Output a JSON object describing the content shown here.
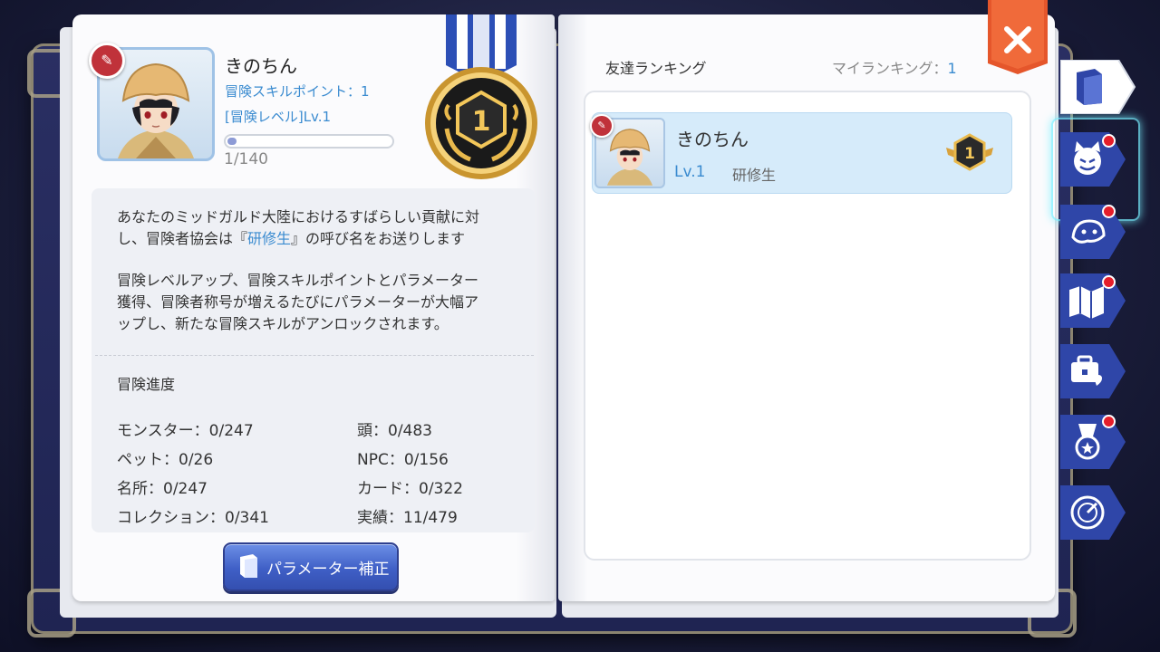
{
  "profile": {
    "name": "きのちん",
    "skill_points": "冒険スキルポイント：1",
    "adventure_level": "[冒険レベル]Lv.1",
    "exp_text": "1/140",
    "exp_progress": 0.007,
    "rank_number": "1"
  },
  "description": {
    "line1": "あなたのミッドガルド大陸におけるすばらしい貢献に対",
    "line2_pre": "し、冒険者協会は『",
    "line2_title": "研修生",
    "line2_post": "』の呼び名をお送りします",
    "para2_line1": "冒険レベルアップ、冒険スキルポイントとパラメーター",
    "para2_line2": "獲得、冒険者称号が増えるたびにパラメーターが大幅ア",
    "para2_line3": "ップし、新たな冒険スキルがアンロックされます。"
  },
  "progress": {
    "title": "冒険進度",
    "left": [
      "モンスター：0/247",
      "ペット：0/26",
      "名所：0/247",
      "コレクション：0/341"
    ],
    "right": [
      "頭：0/483",
      "NPC：0/156",
      "カード：0/322",
      "実績：11/479"
    ]
  },
  "param_button": {
    "label": "パラメーター補正"
  },
  "ranking": {
    "title": "友達ランキング",
    "my_rank_label": "マイランキング：",
    "my_rank_value": "1",
    "rows": [
      {
        "name": "きのちん",
        "level": "Lv.1",
        "class": "研修生",
        "rank": "1"
      }
    ]
  },
  "colors": {
    "accent_blue": "#3a8bd0",
    "close_red": "#e5562b",
    "tab_blue": "#2f46a8",
    "notify_red": "#e51e2a"
  },
  "tabs": [
    {
      "icon": "book-icon",
      "active": true,
      "notify": false
    },
    {
      "icon": "cat-face-icon",
      "active": false,
      "notify": true
    },
    {
      "icon": "pet-icon",
      "active": false,
      "notify": true
    },
    {
      "icon": "map-icon",
      "active": false,
      "notify": true
    },
    {
      "icon": "toolbox-icon",
      "active": false,
      "notify": false
    },
    {
      "icon": "medal-icon",
      "active": false,
      "notify": true
    },
    {
      "icon": "gauge-icon",
      "active": false,
      "notify": false
    }
  ]
}
